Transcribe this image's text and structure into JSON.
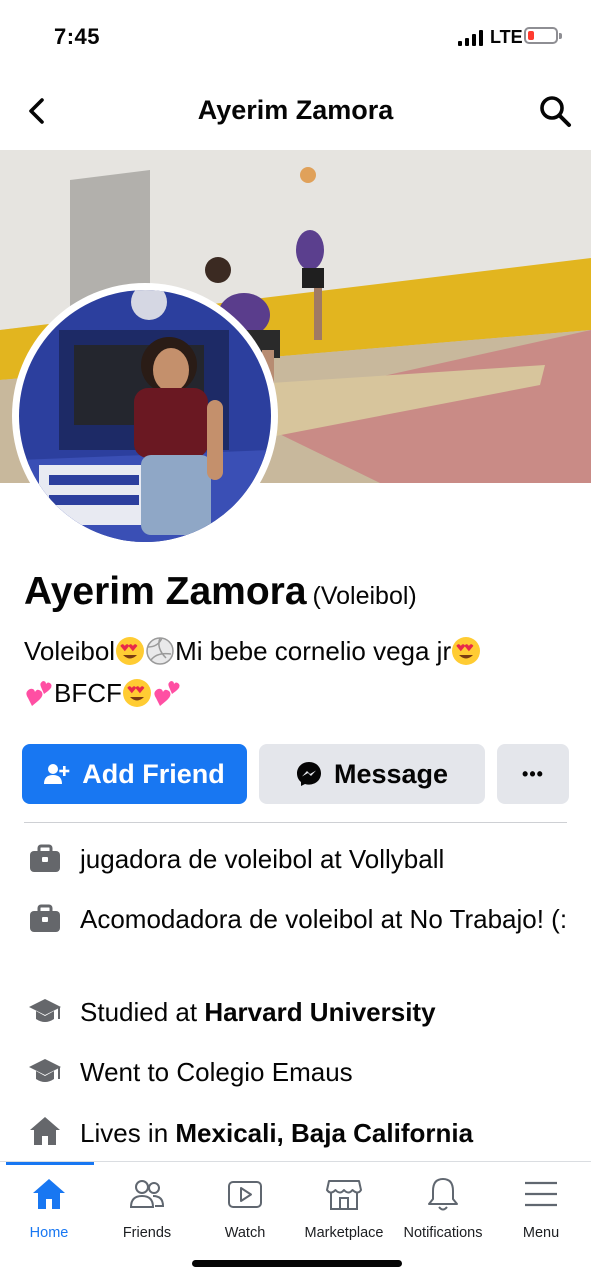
{
  "status_bar": {
    "time": "7:45",
    "network": "LTE"
  },
  "header": {
    "title": "Ayerim Zamora"
  },
  "profile": {
    "name": "Ayerim Zamora",
    "alternate_name": "(Voleibol)",
    "bio_line1_a": "Voleibol",
    "bio_line1_b": "Mi bebe cornelio vega jr",
    "bio_line2": "BFCF"
  },
  "actions": {
    "add_friend": "Add Friend",
    "message": "Message",
    "more": "•••"
  },
  "details": [
    {
      "icon": "briefcase-icon",
      "text": "jugadora de voleibol at Vollyball"
    },
    {
      "icon": "briefcase-icon",
      "text": "Acomodadora de voleibol at No Trabajo! (:"
    },
    {
      "icon": "graduation-cap-icon",
      "prefix": "Studied at ",
      "bold": "Harvard University"
    },
    {
      "icon": "graduation-cap-icon",
      "text": "Went to Colegio Emaus"
    },
    {
      "icon": "home-icon",
      "prefix": "Lives in ",
      "bold": "Mexicali, Baja California"
    }
  ],
  "tabs": [
    {
      "label": "Home",
      "icon": "home-icon",
      "active": true
    },
    {
      "label": "Friends",
      "icon": "friends-icon"
    },
    {
      "label": "Watch",
      "icon": "watch-icon"
    },
    {
      "label": "Marketplace",
      "icon": "marketplace-icon"
    },
    {
      "label": "Notifications",
      "icon": "bell-icon"
    },
    {
      "label": "Menu",
      "icon": "menu-icon"
    }
  ],
  "colors": {
    "accent": "#1877f2",
    "secondary_button": "#e4e6eb",
    "battery_low": "#ff3b30"
  }
}
